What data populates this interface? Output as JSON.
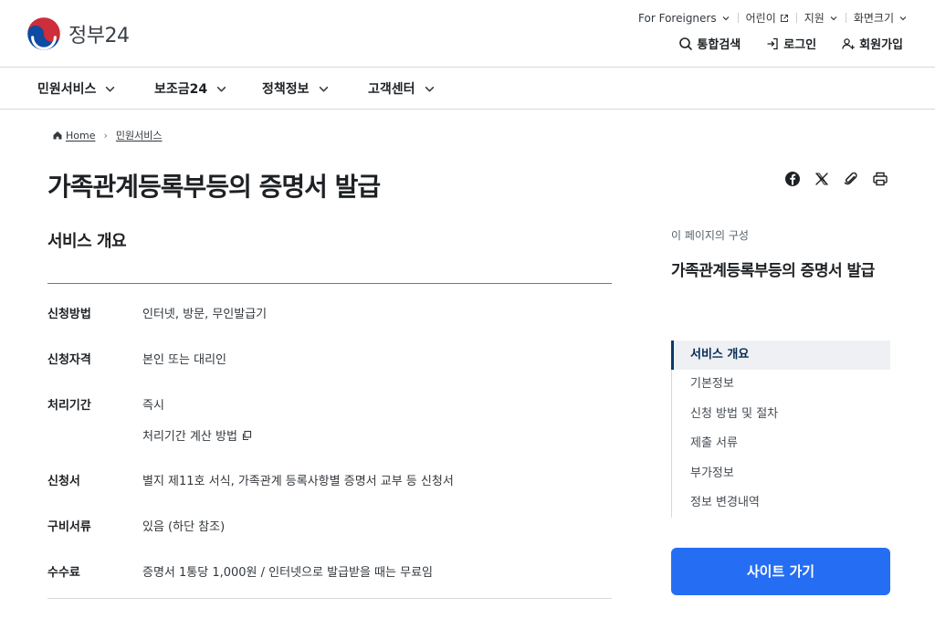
{
  "header": {
    "logo_text": "정부24",
    "util": {
      "foreigners": "For Foreigners",
      "kids": "어린이",
      "support": "지원",
      "screen_size": "화면크기"
    },
    "actions": {
      "search": "통합검색",
      "login": "로그인",
      "signup": "회원가입"
    }
  },
  "gnb": {
    "items": [
      "민원서비스",
      "보조금24",
      "정책정보",
      "고객센터"
    ]
  },
  "breadcrumb": {
    "home": "Home",
    "current": "민원서비스"
  },
  "page": {
    "title": "가족관계등록부등의 증명서 발급"
  },
  "overview": {
    "title": "서비스 개요",
    "rows": [
      {
        "label": "신청방법",
        "value": "인터넷, 방문, 무인발급기"
      },
      {
        "label": "신청자격",
        "value": "본인 또는 대리인"
      },
      {
        "label": "처리기간",
        "value": "즉시",
        "link": "처리기간 계산 방법"
      },
      {
        "label": "신청서",
        "value": "별지 제11호 서식, 가족관계 등록사항별 증명서 교부 등 신청서"
      },
      {
        "label": "구비서류",
        "value": "있음 (하단 참조)"
      },
      {
        "label": "수수료",
        "value": "증명서 1통당 1,000원 / 인터넷으로 발급받을 때는 무료임"
      }
    ]
  },
  "aside": {
    "caption": "이 페이지의 구성",
    "title": "가족관계등록부등의 증명서 발급",
    "toc": [
      "서비스 개요",
      "기본정보",
      "신청 방법 및 절차",
      "제출 서류",
      "부가정보",
      "정보 변경내역"
    ],
    "button": "사이트 가기"
  },
  "colors": {
    "primary_button": "#256ef4",
    "active_toc_bar": "#0b3a6b",
    "logo_red": "#cd2e3a",
    "logo_blue": "#0f4aa3"
  }
}
